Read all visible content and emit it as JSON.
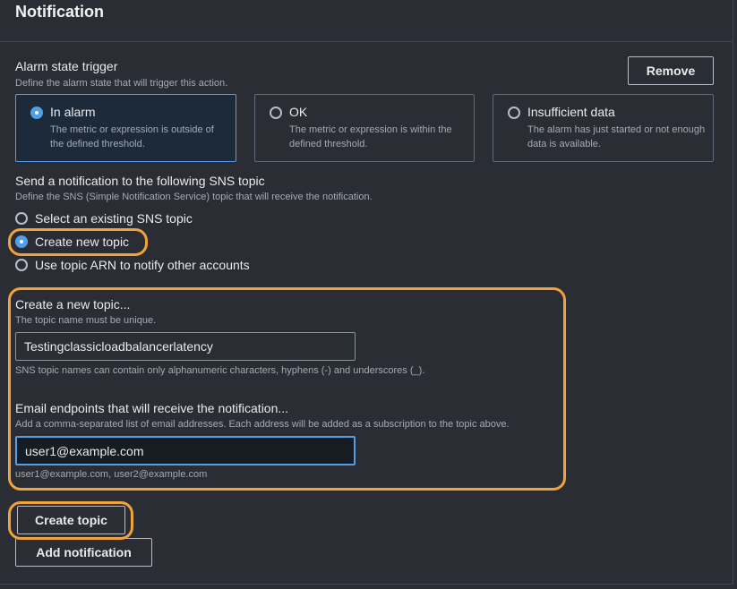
{
  "header": {
    "title": "Notification"
  },
  "alarm_trigger": {
    "label": "Alarm state trigger",
    "description": "Define the alarm state that will trigger this action.",
    "remove_label": "Remove",
    "options": [
      {
        "title": "In alarm",
        "description": "The metric or expression is outside of the defined threshold.",
        "selected": true
      },
      {
        "title": "OK",
        "description": "The metric or expression is within the defined threshold.",
        "selected": false
      },
      {
        "title": "Insufficient data",
        "description": "The alarm has just started or not enough data is available.",
        "selected": false
      }
    ]
  },
  "sns": {
    "label": "Send a notification to the following SNS topic",
    "description": "Define the SNS (Simple Notification Service) topic that will receive the notification.",
    "options": [
      {
        "label": "Select an existing SNS topic",
        "selected": false
      },
      {
        "label": "Create new topic",
        "selected": true
      },
      {
        "label": "Use topic ARN to notify other accounts",
        "selected": false
      }
    ]
  },
  "new_topic": {
    "label": "Create a new topic...",
    "description": "The topic name must be unique.",
    "name_value": "Testingclassicloadbalancerlatency",
    "name_hint": "SNS topic names can contain only alphanumeric characters, hyphens (-) and underscores (_).",
    "email_label": "Email endpoints that will receive the notification...",
    "email_description": "Add a comma-separated list of email addresses. Each address will be added as a subscription to the topic above.",
    "email_value": "user1@example.com",
    "email_hint": "user1@example.com, user2@example.com"
  },
  "actions": {
    "create_topic_label": "Create topic",
    "add_notification_label": "Add notification"
  },
  "colors": {
    "accent": "#539fe5",
    "highlight": "#f0a33a",
    "background": "#2a2d33"
  }
}
